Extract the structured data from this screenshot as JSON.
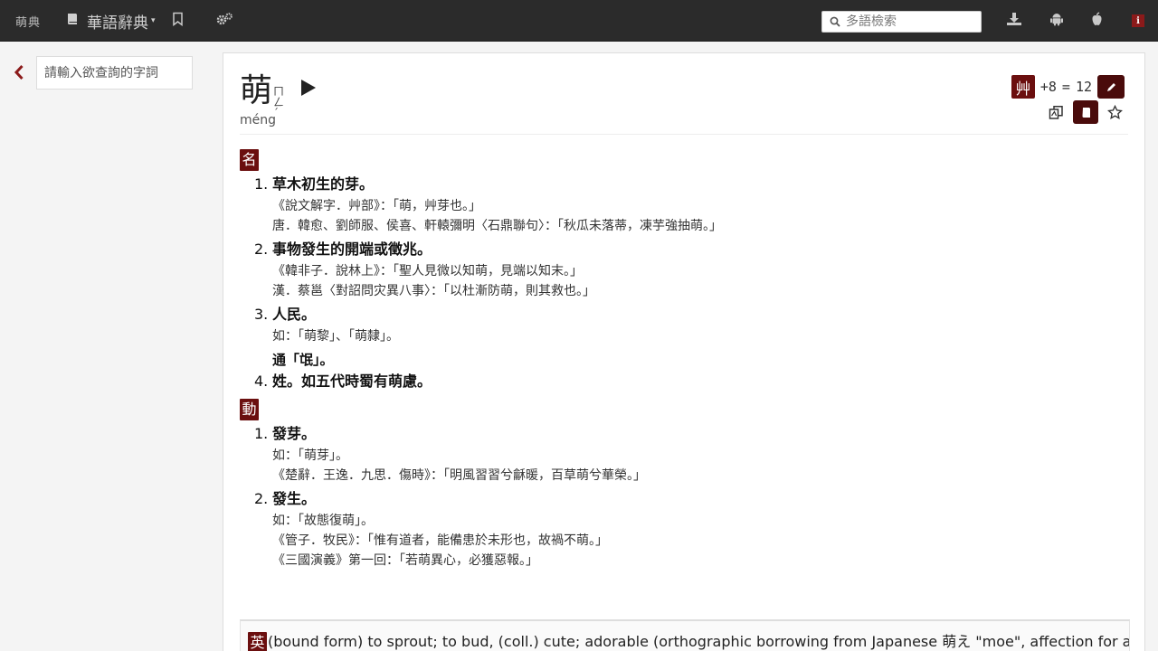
{
  "topbar": {
    "logo": "萌典",
    "dict_label": "華語辭典",
    "search_placeholder": "多語檢索"
  },
  "sidebar": {
    "search_placeholder": "請輸入欲查詢的字詞"
  },
  "entry": {
    "title": "萌",
    "bopomofo": "ㄇㄥˊ",
    "pinyin": "méng",
    "radical": "艸",
    "stroke_extra": "+8",
    "equals": "=",
    "stroke_total": "12"
  },
  "noun": {
    "tag": "名",
    "defs": [
      {
        "num": "1.",
        "text": "草木初生的芽。",
        "examples": [
          "《說文解字．艸部》：「萌，艸芽也。」",
          "唐．韓愈、劉師服、侯喜、軒轅彌明〈石鼎聯句〉：「秋瓜未落蒂，凍芋強抽萌。」"
        ]
      },
      {
        "num": "2.",
        "text": "事物發生的開端或徵兆。",
        "examples": [
          "《韓非子．說林上》：「聖人見微以知萌，見端以知末。」",
          "漢．蔡邕〈對詔問灾異八事〉：「以杜漸防萌，則其救也。」"
        ]
      },
      {
        "num": "3.",
        "text": "人民。",
        "examples": [
          "如：「萌黎」、「萌隸」。"
        ],
        "link": "通「氓」。"
      },
      {
        "num": "4.",
        "text": "姓。如五代時蜀有萌慮。",
        "examples": []
      }
    ]
  },
  "verb": {
    "tag": "動",
    "defs": [
      {
        "num": "1.",
        "text": "發芽。",
        "examples": [
          "如：「萌芽」。",
          "《楚辭．王逸．九思．傷時》：「明風習習兮龢暖，百草萌兮華榮。」"
        ]
      },
      {
        "num": "2.",
        "text": "發生。",
        "examples": [
          "如：「故態復萌」。",
          "《管子．牧民》：「惟有道者，能備患於未形也，故禍不萌。」",
          "《三國演義》第一回：「若萌異心，必獲惡報。」"
        ]
      }
    ]
  },
  "translation": {
    "tag": "英",
    "text": "(bound form) to sprout; to bud, (coll.) cute; adorable (orthographic borrowing from Japanese 萌え \"moe\", affection for an"
  },
  "colors": {
    "accent": "#6b0f0f",
    "topbar": "#2b2b2b"
  }
}
